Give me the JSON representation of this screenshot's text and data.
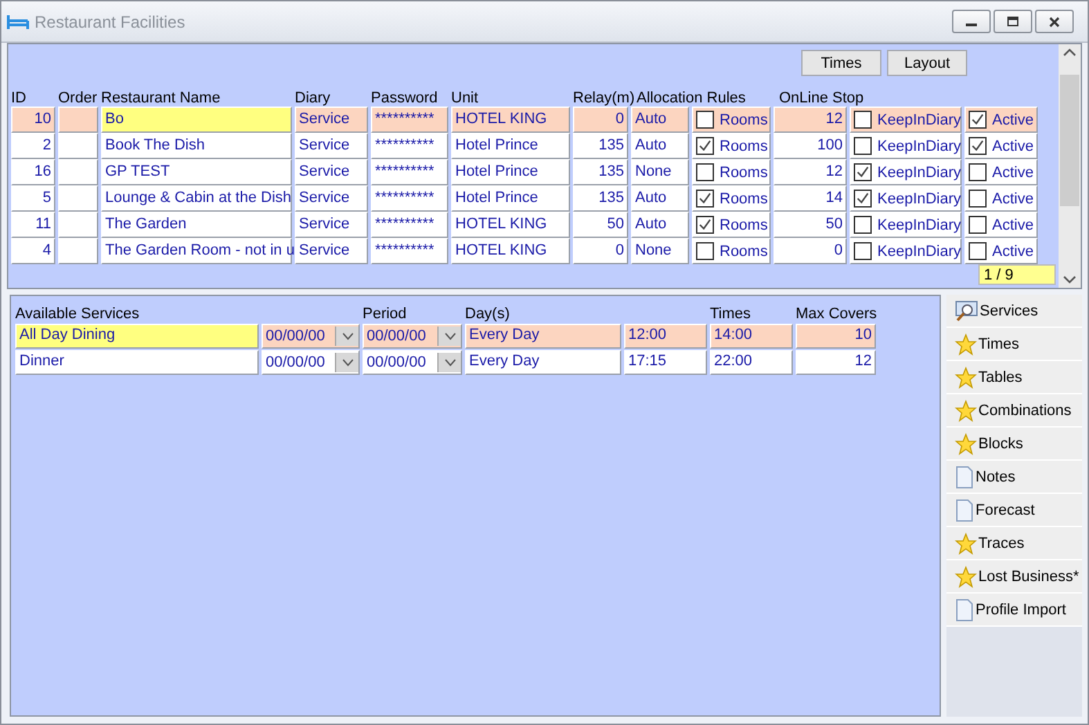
{
  "window": {
    "title": "Restaurant Facilities"
  },
  "toolbar": {
    "buttons": [
      "Times",
      "Layout"
    ]
  },
  "restaurants": {
    "columns": [
      "ID",
      "Order",
      "Restaurant Name",
      "Diary",
      "Password",
      "Unit",
      "Relay(m)",
      "Allocation Rules",
      "OnLine Stop"
    ],
    "rows": [
      {
        "selected": true,
        "id": "10",
        "order": "",
        "name": "Bo",
        "diary": "Service",
        "password": "**********",
        "unit": "HOTEL KING",
        "relay": "0",
        "allocation": "Auto",
        "rooms_checked": false,
        "rooms": "Rooms",
        "online_stop": "12",
        "keep_checked": false,
        "keep": "KeepInDiary",
        "active_checked": true,
        "active": "Active"
      },
      {
        "selected": false,
        "id": "2",
        "order": "",
        "name": "Book The Dish",
        "diary": "Service",
        "password": "**********",
        "unit": "Hotel Prince",
        "relay": "135",
        "allocation": "Auto",
        "rooms_checked": true,
        "rooms": "Rooms",
        "online_stop": "100",
        "keep_checked": false,
        "keep": "KeepInDiary",
        "active_checked": true,
        "active": "Active"
      },
      {
        "selected": false,
        "id": "16",
        "order": "",
        "name": "GP TEST",
        "diary": "Service",
        "password": "**********",
        "unit": "Hotel Prince",
        "relay": "135",
        "allocation": "None",
        "rooms_checked": false,
        "rooms": "Rooms",
        "online_stop": "12",
        "keep_checked": true,
        "keep": "KeepInDiary",
        "active_checked": false,
        "active": "Active"
      },
      {
        "selected": false,
        "id": "5",
        "order": "",
        "name": "Lounge & Cabin at the Dish",
        "diary": "Service",
        "password": "**********",
        "unit": "Hotel Prince",
        "relay": "135",
        "allocation": "Auto",
        "rooms_checked": true,
        "rooms": "Rooms",
        "online_stop": "14",
        "keep_checked": true,
        "keep": "KeepInDiary",
        "active_checked": false,
        "active": "Active"
      },
      {
        "selected": false,
        "id": "11",
        "order": "",
        "name": "The Garden",
        "diary": "Service",
        "password": "**********",
        "unit": "HOTEL KING",
        "relay": "50",
        "allocation": "Auto",
        "rooms_checked": true,
        "rooms": "Rooms",
        "online_stop": "50",
        "keep_checked": false,
        "keep": "KeepInDiary",
        "active_checked": false,
        "active": "Active"
      },
      {
        "selected": false,
        "id": "4",
        "order": "",
        "name": "The Garden Room - not in u",
        "diary": "Service",
        "password": "**********",
        "unit": "HOTEL KING",
        "relay": "0",
        "allocation": "None",
        "rooms_checked": false,
        "rooms": "Rooms",
        "online_stop": "0",
        "keep_checked": false,
        "keep": "KeepInDiary",
        "active_checked": false,
        "active": "Active"
      }
    ],
    "record_counter": "1 / 9"
  },
  "services": {
    "columns": [
      "Available Services",
      "Period",
      "Day(s)",
      "Times",
      "Max Covers"
    ],
    "rows": [
      {
        "selected": true,
        "name": "All Day Dining",
        "period_from": "00/00/00",
        "period_to": "00/00/00",
        "days": "Every Day",
        "time_from": "12:00",
        "time_to": "14:00",
        "max_covers": "10"
      },
      {
        "selected": false,
        "name": "Dinner",
        "period_from": "00/00/00",
        "period_to": "00/00/00",
        "days": "Every Day",
        "time_from": "17:15",
        "time_to": "22:00",
        "max_covers": "12"
      }
    ]
  },
  "sidebar": {
    "items": [
      {
        "label": "Services",
        "kind": "search"
      },
      {
        "label": "Times",
        "kind": "star"
      },
      {
        "label": "Tables",
        "kind": "star"
      },
      {
        "label": "Combinations",
        "kind": "star"
      },
      {
        "label": "Blocks",
        "kind": "star"
      },
      {
        "label": "Notes",
        "kind": "page"
      },
      {
        "label": "Forecast",
        "kind": "page"
      },
      {
        "label": "Traces",
        "kind": "star"
      },
      {
        "label": "Lost Business*",
        "kind": "star"
      },
      {
        "label": "Profile Import",
        "kind": "page"
      }
    ]
  }
}
